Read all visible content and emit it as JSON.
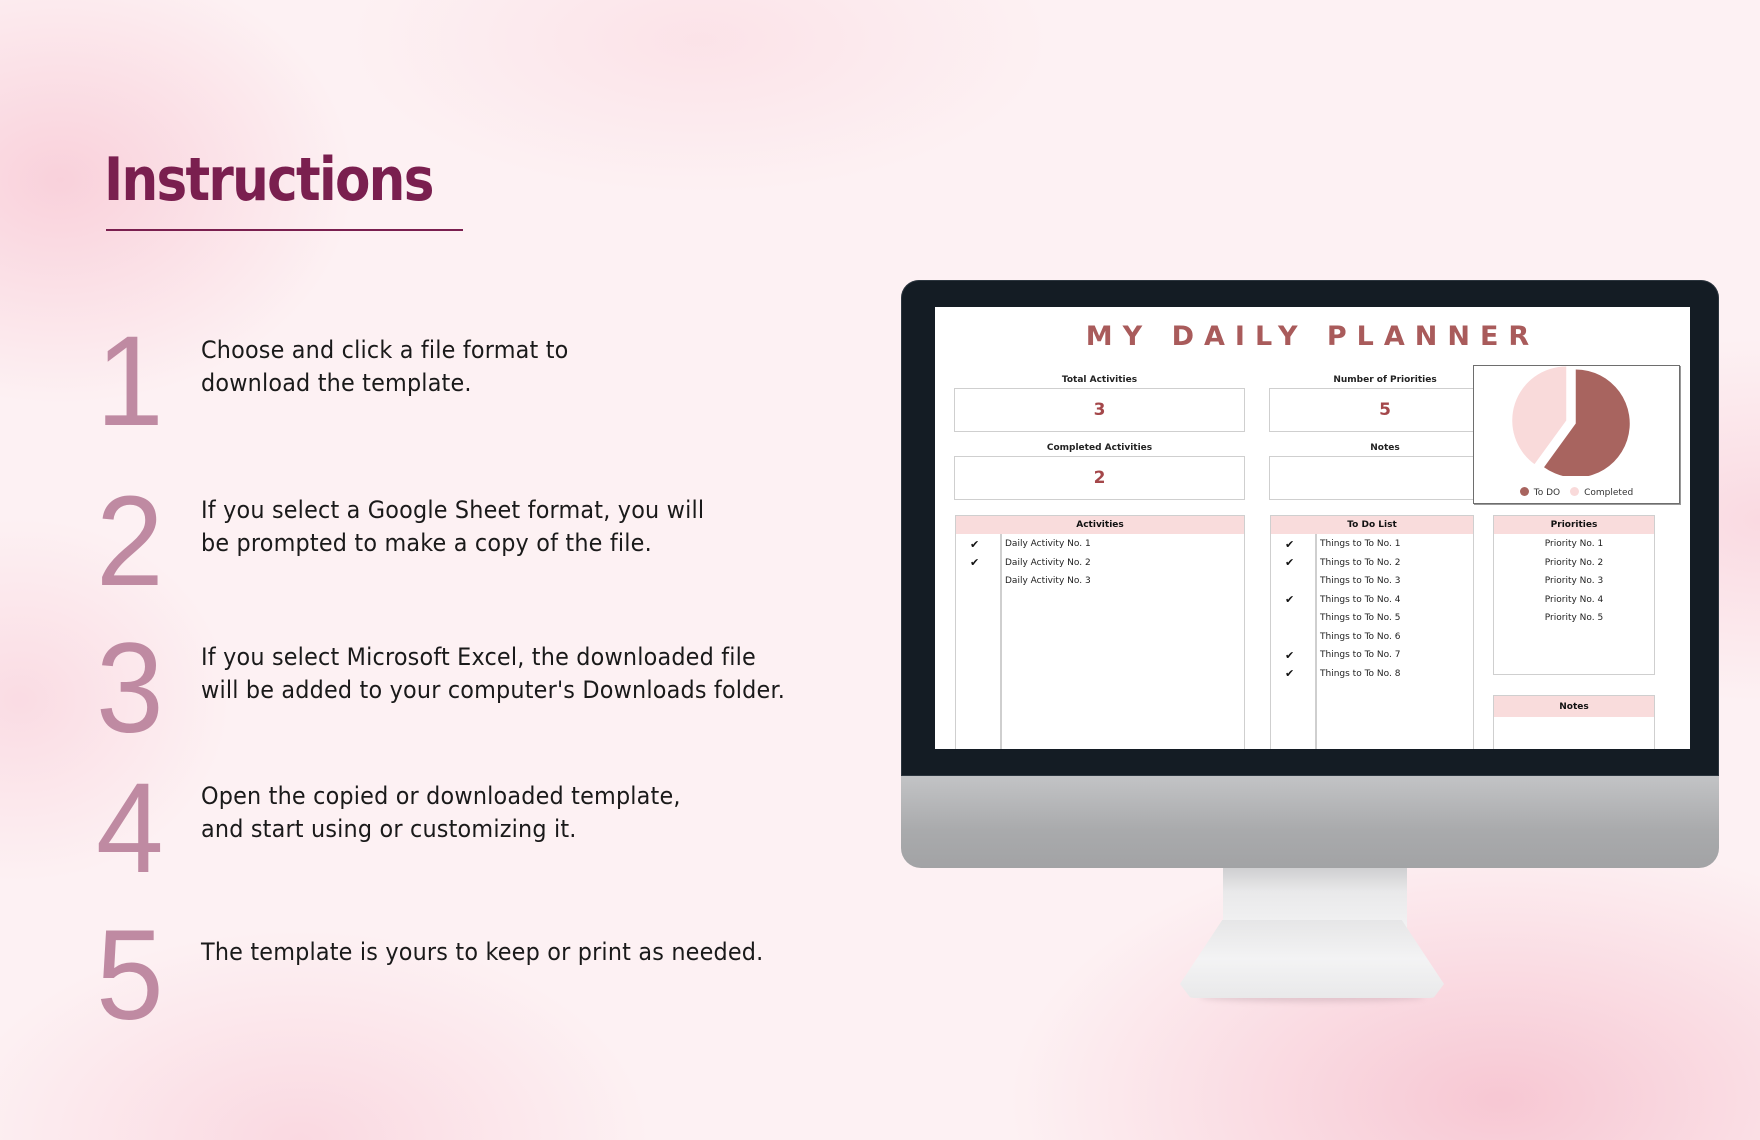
{
  "instructions": {
    "title": "Instructions",
    "steps": [
      {
        "number": "1",
        "lines": [
          "Choose and click a file format to",
          "download the template."
        ]
      },
      {
        "number": "2",
        "lines": [
          "If you select a Google Sheet format, you will",
          "be prompted to make a copy of the file."
        ]
      },
      {
        "number": "3",
        "lines": [
          "If you select Microsoft Excel, the downloaded file",
          "will be added to your computer's Downloads folder."
        ]
      },
      {
        "number": "4",
        "lines": [
          "Open the copied or downloaded template,",
          "and start using or customizing it."
        ]
      },
      {
        "number": "5",
        "lines": [
          "The template is yours to keep or print as needed."
        ]
      }
    ]
  },
  "colors": {
    "title": "#7a1f4f",
    "step_number": "#bf8aa2",
    "planner_accent": "#a95b5b",
    "header_fill": "#f9dcdc",
    "todo_slice": "#a8645f",
    "completed_slice": "#f9dada"
  },
  "planner": {
    "title": "MY DAILY PLANNER",
    "stats": {
      "total_activities": {
        "label": "Total Activities",
        "value": "3"
      },
      "number_of_priorities": {
        "label": "Number of Priorities",
        "value": "5"
      },
      "completed_activities": {
        "label": "Completed Activities",
        "value": "2"
      },
      "notes": {
        "label": "Notes",
        "value": ""
      }
    },
    "activities": {
      "header": "Activities",
      "items": [
        {
          "text": "Daily Activity No. 1",
          "checked": true
        },
        {
          "text": "Daily Activity No. 2",
          "checked": true
        },
        {
          "text": "Daily Activity No. 3",
          "checked": false
        }
      ]
    },
    "todo": {
      "header": "To Do List",
      "items": [
        {
          "text": "Things to To No. 1",
          "checked": true
        },
        {
          "text": "Things to To No. 2",
          "checked": true
        },
        {
          "text": "Things to To No. 3",
          "checked": false
        },
        {
          "text": "Things to To No. 4",
          "checked": true
        },
        {
          "text": "Things to To No. 5",
          "checked": false
        },
        {
          "text": "Things to To No. 6",
          "checked": false
        },
        {
          "text": "Things to To No. 7",
          "checked": true
        },
        {
          "text": "Things to To No. 8",
          "checked": true
        }
      ]
    },
    "priorities": {
      "header": "Priorities",
      "items": [
        "Priority No. 1",
        "Priority No. 2",
        "Priority No. 3",
        "Priority No. 4",
        "Priority No. 5"
      ]
    },
    "notes": {
      "header": "Notes"
    },
    "check_glyph": "✔"
  },
  "chart_data": {
    "type": "pie",
    "title": "",
    "categories": [
      "To DO",
      "Completed"
    ],
    "values": [
      3,
      2
    ],
    "colors": [
      "#a8645f",
      "#f9dada"
    ],
    "legend": "bottom",
    "exploded": true
  }
}
